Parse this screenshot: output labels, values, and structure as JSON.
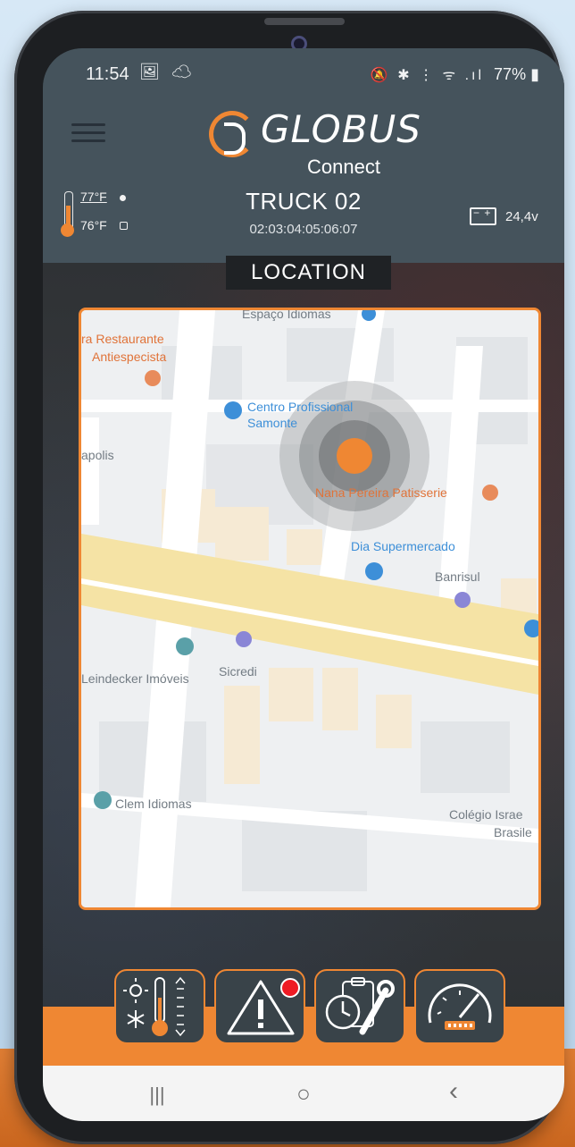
{
  "status_bar": {
    "time": "11:54",
    "left_icons": "🖼 ☁",
    "right_icons": "🔕 ✱ ⋮ ᯤ .ıl",
    "battery_percent": "77%",
    "battery_icon": "battery-icon"
  },
  "header": {
    "logo_text": "GLOBUS",
    "logo_subtext": "Connect",
    "temp_outside": "77°F",
    "temp_inside": "76°F",
    "truck_name": "TRUCK 02",
    "truck_id": "02:03:04:05:06:07",
    "battery_voltage": "24,4v"
  },
  "location": {
    "title": "LOCATION",
    "map_labels": {
      "espaco_idiomas": "Espaço Idiomas",
      "restaurant_line1": "ra Restaurante",
      "restaurant_line2": "Antiespecista",
      "centro_line1": "Centro Profissional",
      "centro_line2": "Samonte",
      "polis": "apolis",
      "nana": "Nana Pereira Patisserie",
      "dia": "Dia Supermercado",
      "banrisul": "Banrisul",
      "leindecker": "Leindecker Imóveis",
      "sicredi": "Sicredi",
      "clem": "Clem Idiomas",
      "colegio_line1": "Colégio Israe",
      "colegio_line2": "Brasile"
    }
  },
  "colors": {
    "accent_orange": "#ef8733",
    "header_slate": "#45535c",
    "alert_red": "#ee1b24"
  },
  "toolbar": {
    "buttons": [
      {
        "icon": "temperature-control-icon"
      },
      {
        "icon": "alert-warning-icon",
        "badge": "notification-dot"
      },
      {
        "icon": "maintenance-clock-wrench-icon"
      },
      {
        "icon": "speedometer-icon"
      }
    ]
  },
  "navbar": {
    "recents_icon": "|||",
    "home_icon": "○",
    "back_icon": "‹"
  }
}
